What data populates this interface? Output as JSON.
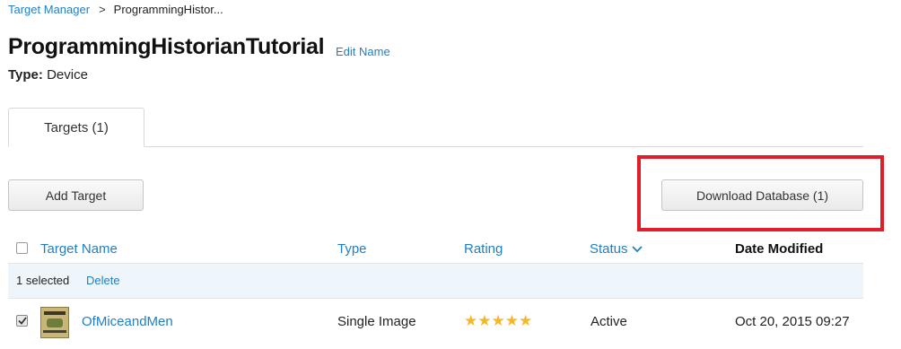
{
  "breadcrumb": {
    "parent": "Target Manager",
    "separator": ">",
    "current": "ProgrammingHistor..."
  },
  "header": {
    "title": "ProgrammingHistorianTutorial",
    "edit_name_label": "Edit Name",
    "type_label": "Type:",
    "type_value": "Device"
  },
  "tabs": [
    {
      "label": "Targets (1)",
      "active": true
    }
  ],
  "toolbar": {
    "add_target_label": "Add Target",
    "download_database_label": "Download Database (1)"
  },
  "table": {
    "columns": {
      "name": "Target Name",
      "type": "Type",
      "rating": "Rating",
      "status": "Status",
      "date": "Date Modified"
    },
    "sort_icon": "chevron-down-icon",
    "selection": {
      "text": "1 selected",
      "delete_label": "Delete"
    },
    "rows": [
      {
        "selected": true,
        "name": "OfMiceandMen",
        "type": "Single Image",
        "rating": 5,
        "rating_stars": "★★★★★",
        "status": "Active",
        "date": "Oct 20, 2015 09:27"
      }
    ]
  },
  "colors": {
    "link": "#1f7fc4",
    "highlight": "#e01e2a",
    "star": "#f6b628",
    "selection_bar": "#eef5fb"
  }
}
